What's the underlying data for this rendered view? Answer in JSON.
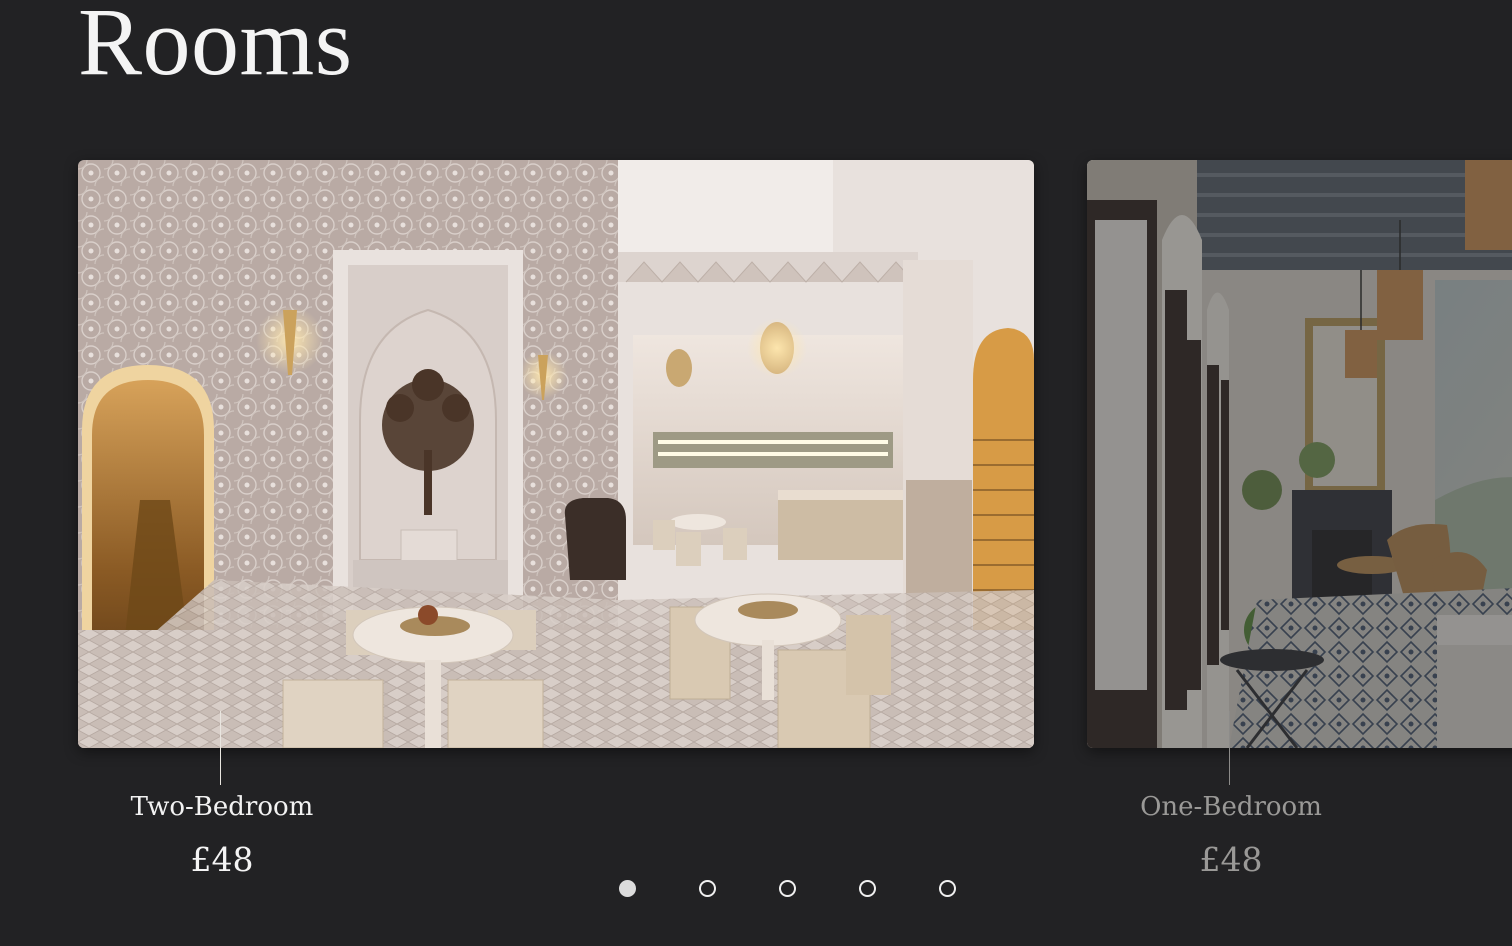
{
  "page": {
    "title": "Rooms"
  },
  "rooms": [
    {
      "name": "Two-Bedroom",
      "price": "£48",
      "image": "riad-courtyard-lounge-photo"
    },
    {
      "name": "One-Bedroom",
      "price": "£48",
      "image": "riad-gallery-sitting-area-photo"
    }
  ],
  "carousel": {
    "slide_count": 5,
    "active_index": 0
  },
  "colors": {
    "background": "#222224",
    "text": "#f2f2f2",
    "muted_text": "#9a9997"
  }
}
